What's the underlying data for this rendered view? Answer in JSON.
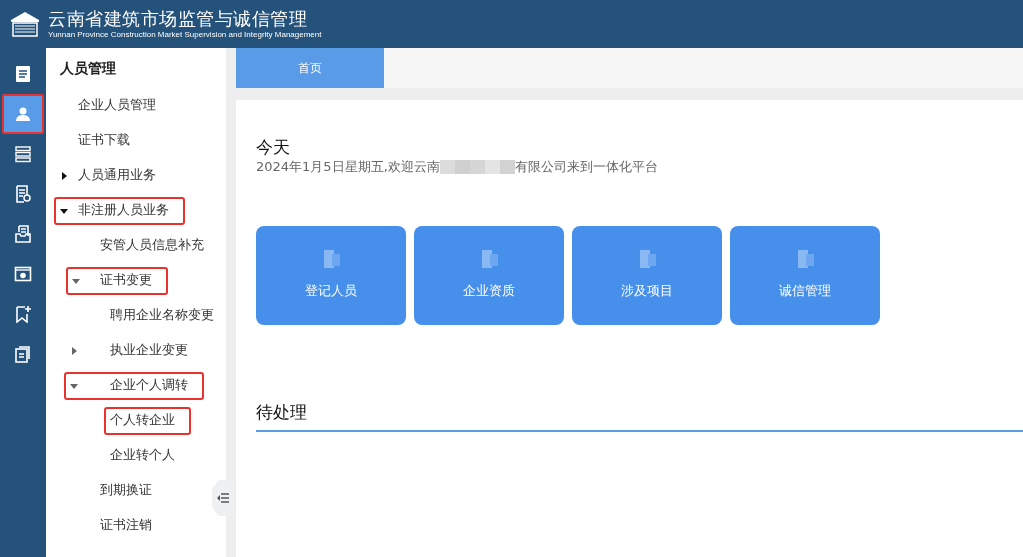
{
  "header": {
    "title": "云南省建筑市场监管与诚信管理",
    "subtitle": "Yunnan Province Construction Market Supervision and Integrity Management"
  },
  "rail": [
    {
      "selected": false,
      "highlighted": false
    },
    {
      "selected": true,
      "highlighted": true
    },
    {
      "selected": false,
      "highlighted": false
    },
    {
      "selected": false,
      "highlighted": false
    },
    {
      "selected": false,
      "highlighted": false
    },
    {
      "selected": false,
      "highlighted": false
    },
    {
      "selected": false,
      "highlighted": false
    },
    {
      "selected": false,
      "highlighted": false
    }
  ],
  "sidebar": {
    "title": "人员管理",
    "items": [
      {
        "label": "企业人员管理",
        "highlighted": false
      },
      {
        "label": "证书下载",
        "highlighted": false
      },
      {
        "label": "人员通用业务",
        "expanded": false,
        "highlighted": false
      },
      {
        "label": "非注册人员业务",
        "expanded": true,
        "highlighted": true,
        "children": [
          {
            "label": "安管人员信息补充",
            "highlighted": false
          },
          {
            "label": "证书变更",
            "expanded": true,
            "highlighted": true,
            "children": [
              {
                "label": "聘用企业名称变更",
                "highlighted": false
              },
              {
                "label": "执业企业变更",
                "expanded": false,
                "highlighted": false
              },
              {
                "label": "企业个人调转",
                "expanded": true,
                "highlighted": true,
                "children": [
                  {
                    "label": "个人转企业",
                    "highlighted": true
                  },
                  {
                    "label": "企业转个人",
                    "highlighted": false
                  }
                ]
              }
            ]
          },
          {
            "label": "到期换证",
            "highlighted": false
          },
          {
            "label": "证书注销",
            "highlighted": false
          }
        ]
      }
    ]
  },
  "tabs": [
    {
      "label": "首页",
      "selected": true
    }
  ],
  "today": {
    "title": "今天",
    "welcome_before": "2024年1月5日星期五,欢迎云南",
    "welcome_after": "有限公司来到一体化平台"
  },
  "tiles": [
    {
      "label": "登记人员"
    },
    {
      "label": "企业资质"
    },
    {
      "label": "涉及项目"
    },
    {
      "label": "诚信管理"
    }
  ],
  "pending": {
    "title": "待处理"
  }
}
